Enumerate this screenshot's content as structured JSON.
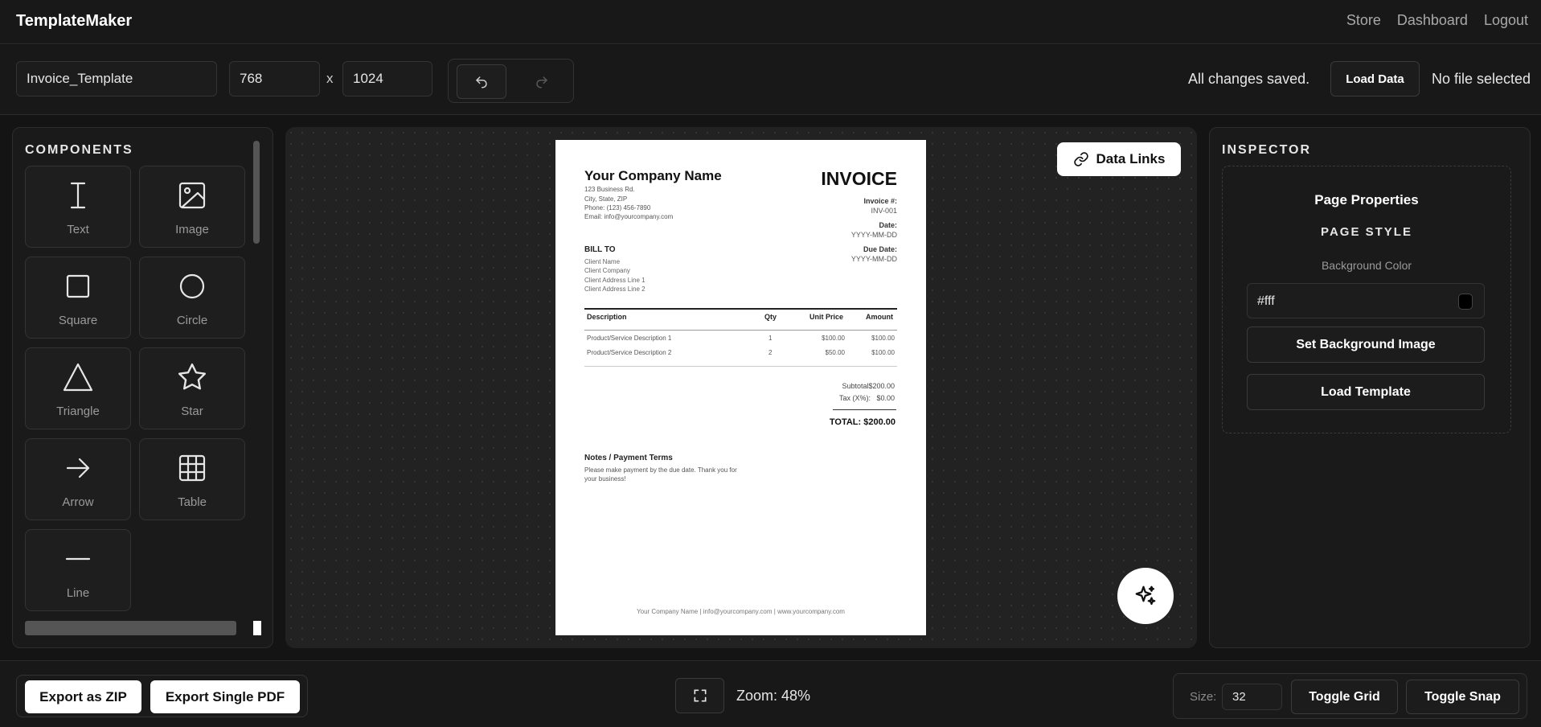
{
  "app": {
    "brand": "TemplateMaker",
    "nav": [
      "Store",
      "Dashboard",
      "Logout"
    ]
  },
  "toolbar": {
    "template_name": "Invoice_Template",
    "width": "768",
    "x_label": "x",
    "height": "1024",
    "status": "All changes saved.",
    "load_data_label": "Load Data",
    "file_status": "No file selected"
  },
  "components": {
    "title": "COMPONENTS",
    "items": [
      {
        "label": "Text",
        "icon": "text-cursor-icon"
      },
      {
        "label": "Image",
        "icon": "image-icon"
      },
      {
        "label": "Square",
        "icon": "square-icon"
      },
      {
        "label": "Circle",
        "icon": "circle-icon"
      },
      {
        "label": "Triangle",
        "icon": "triangle-icon"
      },
      {
        "label": "Star",
        "icon": "star-icon"
      },
      {
        "label": "Arrow",
        "icon": "arrow-right-icon"
      },
      {
        "label": "Table",
        "icon": "table-icon"
      },
      {
        "label": "Line",
        "icon": "line-icon"
      }
    ]
  },
  "canvas": {
    "data_links_label": "Data Links"
  },
  "invoice": {
    "company_name": "Your Company Name",
    "address1": "123 Business Rd.",
    "address2": "City, State, ZIP",
    "phone": "Phone: (123) 456-7890",
    "email": "Email: info@yourcompany.com",
    "title": "INVOICE",
    "invoice_no_label": "Invoice #:",
    "invoice_no": "INV-001",
    "date_label": "Date:",
    "date": "YYYY-MM-DD",
    "due_label": "Due Date:",
    "due": "YYYY-MM-DD",
    "bill_to": "BILL TO",
    "client_name": "Client Name",
    "client_company": "Client Company",
    "client_addr1": "Client Address Line 1",
    "client_addr2": "Client Address Line 2",
    "columns": [
      "Description",
      "Qty",
      "Unit Price",
      "Amount"
    ],
    "rows": [
      [
        "Product/Service Description 1",
        "1",
        "$100.00",
        "$100.00"
      ],
      [
        "Product/Service Description 2",
        "2",
        "$50.00",
        "$100.00"
      ]
    ],
    "subtotal": "Subtotal$200.00",
    "tax": "Tax (X%):   $0.00",
    "total": "TOTAL: $200.00",
    "notes_title": "Notes / Payment Terms",
    "notes_line1": "Please make payment by the due date. Thank you for",
    "notes_line2": "your business!",
    "footer": "Your Company Name | info@yourcompany.com | www.yourcompany.com"
  },
  "inspector": {
    "title": "INSPECTOR",
    "heading": "Page Properties",
    "subheading": "PAGE STYLE",
    "bg_label": "Background Color",
    "bg_value": "#fff",
    "set_bg_image": "Set Background Image",
    "load_template": "Load Template"
  },
  "bottom": {
    "export_zip": "Export as ZIP",
    "export_pdf": "Export Single PDF",
    "zoom": "Zoom: 48%",
    "size_label": "Size:",
    "size_value": "32",
    "toggle_grid": "Toggle Grid",
    "toggle_snap": "Toggle Snap"
  }
}
